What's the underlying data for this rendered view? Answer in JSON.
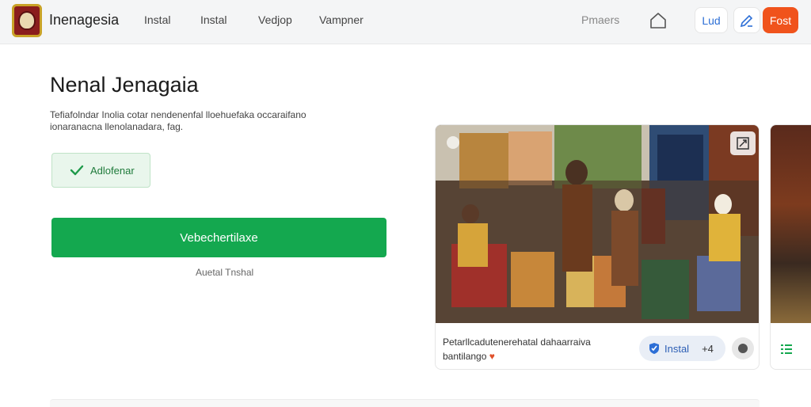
{
  "header": {
    "brand": "Inenagesia",
    "nav": [
      "Instal",
      "Instal",
      "Vedjop",
      "Vampner"
    ],
    "right_link": "Pmaers",
    "login_label": "Lud",
    "cta_label": "Fost",
    "icons": [
      "logo-emblem",
      "home-icon",
      "edit-icon"
    ]
  },
  "main": {
    "title": "Nenal Jenagaia",
    "description": "Tefiafolndar Inolia cotar nendenenfal lloehuefaka occaraifano ionaranacna llenolanadara, fag.",
    "status_label": "Adlofenar",
    "primary_button": "Vebechertilaxe",
    "sub_link": "Auetal Tnshal"
  },
  "card": {
    "caption": "Petarllcadutenerehatal dahaarraiva bantilango",
    "install_label": "Instal",
    "install_count": "+4",
    "colors": {
      "heart": "#e0502a",
      "install_shield": "#2d6fd6"
    }
  },
  "colors": {
    "accent_green": "#14a84f",
    "cta_orange": "#f0531c",
    "link_blue": "#2d6fd6"
  }
}
